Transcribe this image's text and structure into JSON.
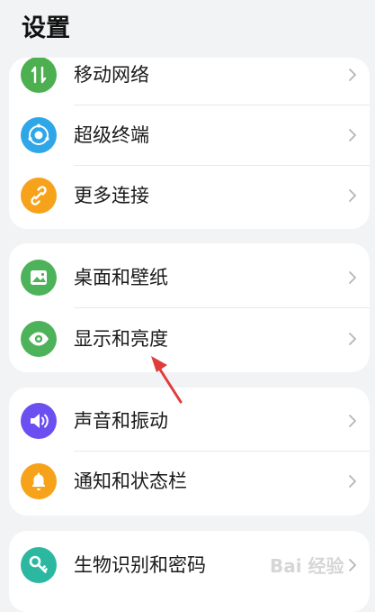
{
  "header": {
    "title": "设置"
  },
  "colors": {
    "mobile_network": "#4caf50",
    "super_device": "#2ea6e8",
    "more_connections": "#f7a21b",
    "desktop_wallpaper": "#4db35a",
    "display_brightness": "#4db35a",
    "sound_vibration": "#6b4ff0",
    "notifications": "#f7a21b",
    "biometrics": "#2cb8a0",
    "annotation_arrow": "#e03c3c"
  },
  "groups": [
    {
      "items": [
        {
          "label": "移动网络",
          "icon": "updown-arrows-icon"
        },
        {
          "label": "超级终端",
          "icon": "super-device-icon"
        },
        {
          "label": "更多连接",
          "icon": "link-icon"
        }
      ]
    },
    {
      "items": [
        {
          "label": "桌面和壁纸",
          "icon": "image-icon"
        },
        {
          "label": "显示和亮度",
          "icon": "eye-icon"
        }
      ]
    },
    {
      "items": [
        {
          "label": "声音和振动",
          "icon": "speaker-icon"
        },
        {
          "label": "通知和状态栏",
          "icon": "bell-icon"
        }
      ]
    },
    {
      "items": [
        {
          "label": "生物识别和密码",
          "icon": "key-icon"
        }
      ]
    }
  ],
  "watermark": {
    "text": "Bai 经验"
  }
}
